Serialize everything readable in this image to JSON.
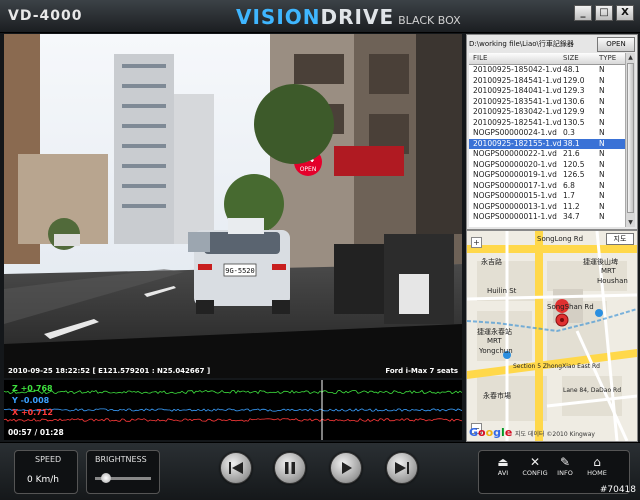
{
  "header": {
    "model": "VD-4000",
    "brand_a": "VISION",
    "brand_b": "DRIVE",
    "brand_sub": "BLACK BOX",
    "win_minimize": "_",
    "win_maximize": "□",
    "win_close": "X"
  },
  "video": {
    "timestamp": "2010-09-25 18:22:52 [ E121.579201 : N25.042667 ]",
    "vehicle": "Ford i-Max 7 seats",
    "sign_text": "24",
    "sign_sub": "OPEN",
    "plate": "9G-5520"
  },
  "filelist": {
    "path": "D:\\working file\\Liao\\行車記錄器",
    "open_label": "OPEN",
    "columns": [
      "FILE",
      "SIZE",
      "TYPE"
    ],
    "rows": [
      {
        "file": "20100925-185042-1.vd",
        "size": "48.1",
        "type": "N"
      },
      {
        "file": "20100925-184541-1.vd",
        "size": "129.0",
        "type": "N"
      },
      {
        "file": "20100925-184041-1.vd",
        "size": "129.3",
        "type": "N"
      },
      {
        "file": "20100925-183541-1.vd",
        "size": "130.6",
        "type": "N"
      },
      {
        "file": "20100925-183042-1.vd",
        "size": "129.9",
        "type": "N"
      },
      {
        "file": "20100925-182541-1.vd",
        "size": "130.5",
        "type": "N"
      },
      {
        "file": "NOGPS00000024-1.vd",
        "size": "0.3",
        "type": "N"
      },
      {
        "file": "20100925-182155-1.vd",
        "size": "38.1",
        "type": "N"
      },
      {
        "file": "NOGPS00000022-1.vd",
        "size": "21.6",
        "type": "N"
      },
      {
        "file": "NOGPS00000020-1.vd",
        "size": "120.5",
        "type": "N"
      },
      {
        "file": "NOGPS00000019-1.vd",
        "size": "126.5",
        "type": "N"
      },
      {
        "file": "NOGPS00000017-1.vd",
        "size": "6.8",
        "type": "N"
      },
      {
        "file": "NOGPS00000015-1.vd",
        "size": "1.7",
        "type": "N"
      },
      {
        "file": "NOGPS00000013-1.vd",
        "size": "11.2",
        "type": "N"
      },
      {
        "file": "NOGPS00000011-1.vd",
        "size": "34.7",
        "type": "N"
      }
    ],
    "selected_index": 7
  },
  "map": {
    "map_button": "지도",
    "zoom_in": "+",
    "zoom_out": "−",
    "labels": {
      "songlong_rd": "SongLong Rd",
      "yongji": "永吉路",
      "houshan_mrt": "捷運後山埤",
      "mrt": "MRT",
      "houshan": "Houshan",
      "huilin": "Huilin St",
      "songshan_rd": "SongShan Rd",
      "yongchun_cn": "捷運永春站",
      "mrt2": "MRT",
      "yongchun": "Yongchun",
      "section5": "Section 5 ZhongXiao East Rd",
      "lane84": "Lane 84, DaDao Rd",
      "xinyi": "永春市場",
      "copyright": "지도 데이터 ©2010 Kingway"
    },
    "google": "Google"
  },
  "graph": {
    "z_label": "Z +0.768",
    "y_label": "Y -0.008",
    "x_label": "X +0.712",
    "time": "00:57 / 01:28",
    "colors": {
      "z": "#3ee03e",
      "y": "#3aa0ff",
      "x": "#ff3a3a"
    }
  },
  "controls": {
    "speed_label": "SPEED",
    "speed_value": "0 Km/h",
    "brightness_label": "BRIGHTNESS",
    "brightness_level": 0.2,
    "tools": [
      {
        "label": "AVI",
        "icon": "export-icon"
      },
      {
        "label": "CONFIG",
        "icon": "tools-icon"
      },
      {
        "label": "INFO",
        "icon": "pen-icon"
      },
      {
        "label": "HOME",
        "icon": "home-icon"
      }
    ]
  },
  "watermark": "#70418"
}
